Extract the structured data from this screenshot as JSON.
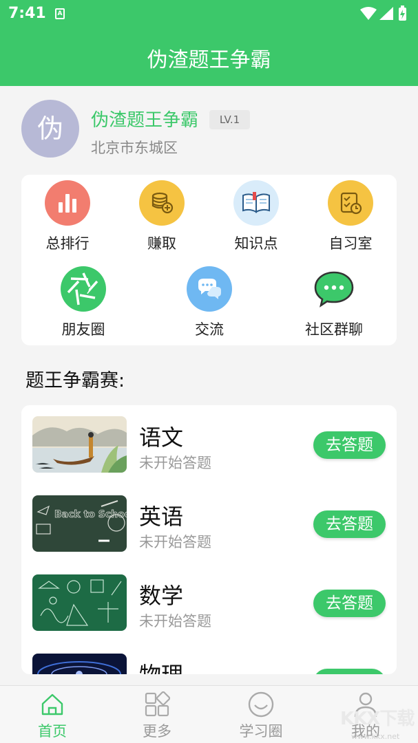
{
  "status_bar": {
    "time": "7:41",
    "notification_badge": "A"
  },
  "header": {
    "title": "伪渣题王争霸"
  },
  "profile": {
    "avatar_char": "伪",
    "name": "伪渣题王争霸",
    "level": "LV.1",
    "location": "北京市东城区"
  },
  "menu": {
    "row1": [
      {
        "label": "总排行",
        "icon": "bar-chart-icon",
        "color": "#f27d6f"
      },
      {
        "label": "赚取",
        "icon": "coins-icon",
        "color": "#f5c342"
      },
      {
        "label": "知识点",
        "icon": "open-book-icon",
        "color": "#d9ecfa"
      },
      {
        "label": "自习室",
        "icon": "checklist-clock-icon",
        "color": "#f5c342"
      }
    ],
    "row2": [
      {
        "label": "朋友圈",
        "icon": "aperture-icon",
        "color": "#3cc86a"
      },
      {
        "label": "交流",
        "icon": "chat-bubbles-icon",
        "color": "#6fb8f2"
      },
      {
        "label": "社区群聊",
        "icon": "wechat-icon",
        "color": "#3cc86a"
      }
    ]
  },
  "section_title": "题王争霸赛:",
  "subjects": [
    {
      "name": "语文",
      "status": "未开始答题",
      "button": "去答题",
      "thumb": "ink-painting-boat-image"
    },
    {
      "name": "英语",
      "status": "未开始答题",
      "button": "去答题",
      "thumb": "back-to-school-chalkboard-image",
      "thumb_text": "Back to School"
    },
    {
      "name": "数学",
      "status": "未开始答题",
      "button": "去答题",
      "thumb": "math-chalkboard-image"
    },
    {
      "name": "物理",
      "status": "",
      "button": "",
      "thumb": "physics-space-image"
    }
  ],
  "bottom_nav": [
    {
      "label": "首页",
      "icon": "home-icon",
      "active": true
    },
    {
      "label": "更多",
      "icon": "grid-icon",
      "active": false
    },
    {
      "label": "学习圈",
      "icon": "smile-icon",
      "active": false
    },
    {
      "label": "我的",
      "icon": "user-icon",
      "active": false
    }
  ],
  "watermark": {
    "text": "KKX下载",
    "url": "www.kkx.net"
  },
  "colors": {
    "brand": "#3cc86a",
    "background": "#f4f4f4"
  }
}
